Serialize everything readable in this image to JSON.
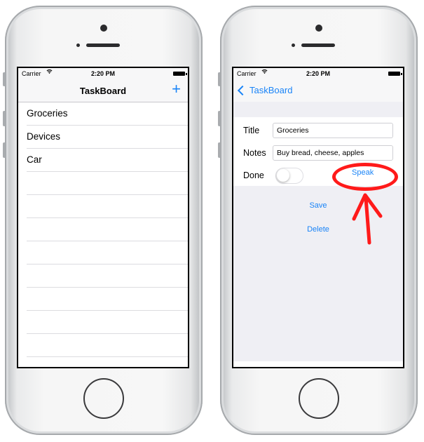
{
  "left_phone": {
    "status_bar": {
      "carrier": "Carrier",
      "wifi_icon": "wifi-icon",
      "time": "2:20 PM",
      "battery_icon": "battery-icon"
    },
    "nav": {
      "title": "TaskBoard",
      "add_label": "+"
    },
    "tasks": [
      {
        "label": "Groceries"
      },
      {
        "label": "Devices"
      },
      {
        "label": "Car"
      }
    ]
  },
  "right_phone": {
    "status_bar": {
      "carrier": "Carrier",
      "wifi_icon": "wifi-icon",
      "time": "2:20 PM",
      "battery_icon": "battery-icon"
    },
    "nav": {
      "back_label": "TaskBoard"
    },
    "form": {
      "title_label": "Title",
      "title_value": "Groceries",
      "notes_label": "Notes",
      "notes_value": "Buy bread, cheese, apples",
      "done_label": "Done",
      "done_on": false,
      "speak_label": "Speak"
    },
    "actions": {
      "save_label": "Save",
      "delete_label": "Delete"
    }
  },
  "annotation": {
    "color": "#ff1a1a",
    "shapes": [
      "circle",
      "arrow"
    ],
    "target": "speak-button"
  },
  "colors": {
    "accent": "#1a84f7",
    "group_background": "#efeff4"
  }
}
